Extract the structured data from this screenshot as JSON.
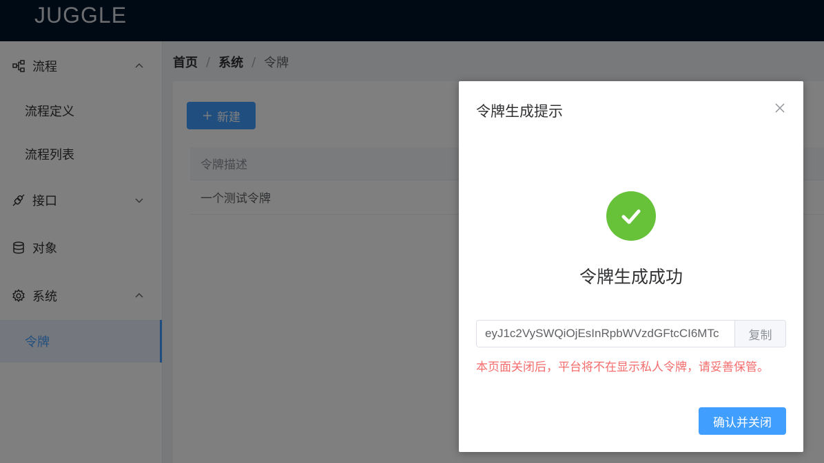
{
  "header": {
    "logo": "JUGGLE"
  },
  "sidebar": {
    "items": [
      {
        "label": "流程",
        "icon": "flow-icon",
        "arrow": "up"
      },
      {
        "label": "流程定义"
      },
      {
        "label": "流程列表"
      },
      {
        "label": "接口",
        "icon": "api-icon",
        "arrow": "down"
      },
      {
        "label": "对象",
        "icon": "database-icon"
      },
      {
        "label": "系统",
        "icon": "gear-icon",
        "arrow": "up"
      },
      {
        "label": "令牌",
        "active": true
      }
    ]
  },
  "breadcrumb": {
    "home": "首页",
    "system": "系统",
    "current": "令牌",
    "separator": "/"
  },
  "toolbar": {
    "new_label": "新建",
    "new_icon": "plus-icon"
  },
  "table": {
    "header": "令牌描述",
    "rows": [
      "一个测试令牌"
    ]
  },
  "dialog": {
    "title": "令牌生成提示",
    "success_text": "令牌生成成功",
    "token_value": "eyJ1c2VySWQiOjEsInRpbWVzdGFtcCI6MTc",
    "copy_label": "复制",
    "warning": "本页面关闭后，平台将不在显示私人令牌，请妥善保管。",
    "confirm_label": "确认并关闭"
  },
  "colors": {
    "primary": "#409eff",
    "success": "#67c23a",
    "danger": "#f56c6c",
    "header_bg": "#001529"
  }
}
